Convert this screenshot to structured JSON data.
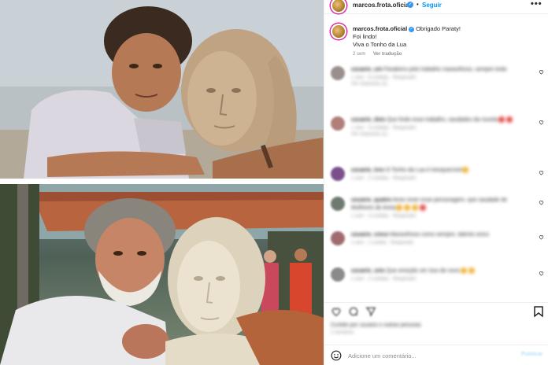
{
  "post": {
    "username": "marcos.frota.oficial",
    "follow_label": "Seguir",
    "dot_separator": "•",
    "more_label": "•••"
  },
  "caption": {
    "username": "marcos.frota.oficial",
    "text_line1": "Obrigado Paraty!",
    "text_line2": "Foi lindo!",
    "text_line3": "Viva o Tonho da Lua",
    "time": "2 sem",
    "translate_label": "Ver tradução"
  },
  "comments": [
    {
      "user": "usuario_um",
      "text": "Parabéns pelo trabalho maravilhoso, sempre lindo",
      "time": "1 sem",
      "likes": "8 curtidas",
      "reply": "Responder",
      "replies": "Ver respostas (2)"
    },
    {
      "user": "usuario_dois",
      "text": "Que lindo esse trabalho, saudades da novela",
      "time": "1 sem",
      "likes": "3 curtidas",
      "reply": "Responder",
      "replies": "Ver respostas (1)"
    },
    {
      "user": "usuario_tres",
      "text": "O Tonho da Lua é inesquecível",
      "time": "1 sem",
      "likes": "2 curtidas",
      "reply": "Responder",
      "replies": ""
    },
    {
      "user": "usuario_quatro",
      "text": "Amei rever esse personagem, que saudade de Mulheres de Areia",
      "time": "1 sem",
      "likes": "4 curtidas",
      "reply": "Responder",
      "replies": ""
    },
    {
      "user": "usuario_cinco",
      "text": "Maravilhoso como sempre, talento único",
      "time": "1 sem",
      "likes": "1 curtida",
      "reply": "Responder",
      "replies": ""
    },
    {
      "user": "usuario_seis",
      "text": "Que emoção ver isso de novo",
      "time": "1 sem",
      "likes": "2 curtidas",
      "reply": "Responder",
      "replies": ""
    }
  ],
  "likes": {
    "text": "Curtido por usuario e outras pessoas",
    "time": "2 semanas"
  },
  "add_comment": {
    "placeholder": "Adicione um comentário...",
    "post_label": "Publicar"
  },
  "colors": {
    "accent": "#0095f6",
    "verified": "#3897f0",
    "text": "#262626",
    "muted": "#8e8e8e"
  },
  "icons": [
    "verified-badge-icon",
    "more-options-icon",
    "heart-icon",
    "comment-icon",
    "share-icon",
    "bookmark-icon",
    "emoji-icon"
  ]
}
